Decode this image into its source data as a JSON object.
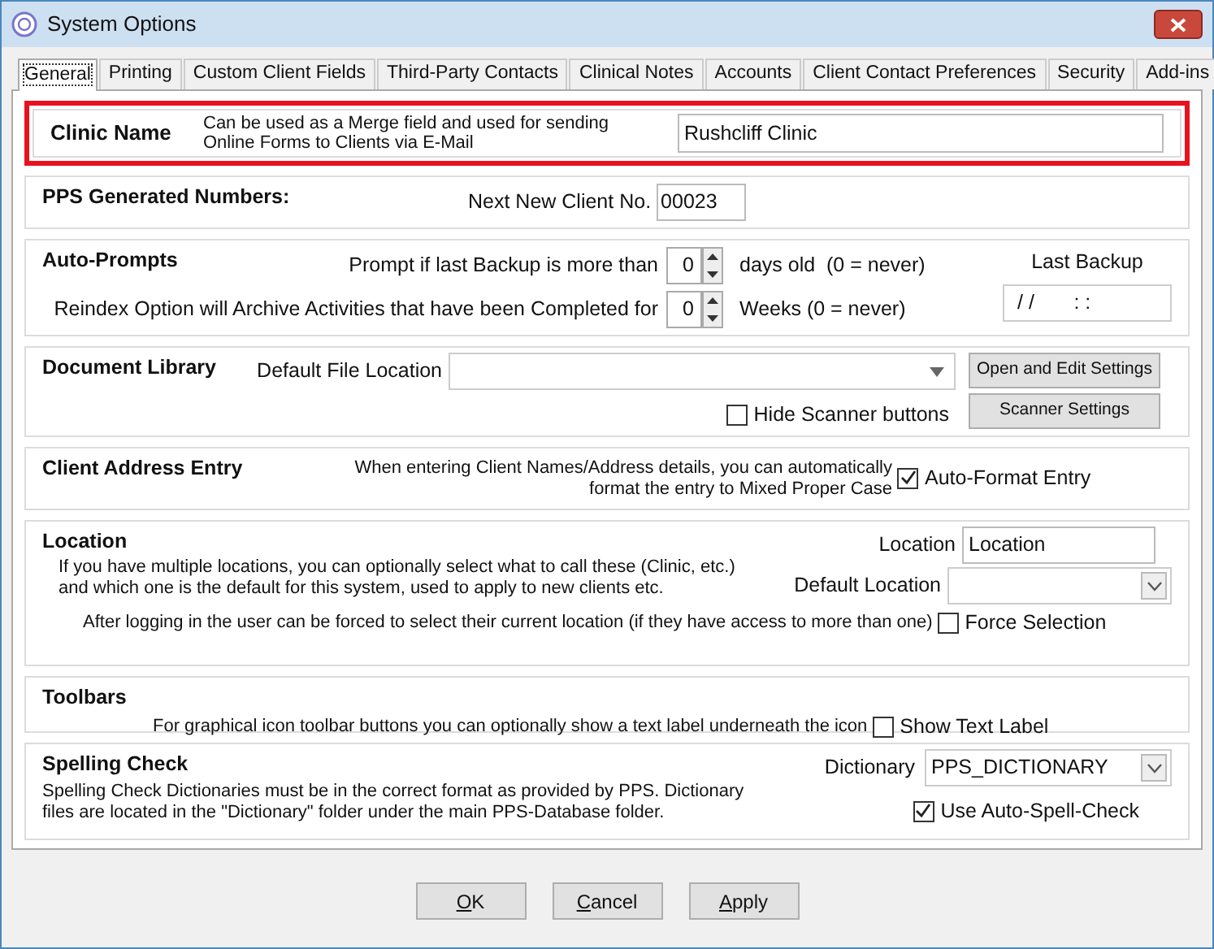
{
  "window": {
    "title": "System Options"
  },
  "tabs": [
    {
      "label": "General",
      "selected": true
    },
    {
      "label": "Printing",
      "selected": false
    },
    {
      "label": "Custom Client Fields",
      "selected": false
    },
    {
      "label": "Third-Party Contacts",
      "selected": false
    },
    {
      "label": "Clinical Notes",
      "selected": false
    },
    {
      "label": "Accounts",
      "selected": false
    },
    {
      "label": "Client Contact Preferences",
      "selected": false
    },
    {
      "label": "Security",
      "selected": false
    },
    {
      "label": "Add-ins",
      "selected": false
    }
  ],
  "clinic_name": {
    "title": "Clinic Name",
    "hint": "Can be used as a Merge field and used for sending Online Forms to Clients via E-Mail",
    "value": "Rushcliff Clinic",
    "highlighted": true
  },
  "pps_numbers": {
    "title": "PPS Generated Numbers:",
    "label": "Next New Client No.",
    "value": "00023"
  },
  "auto_prompts": {
    "title": "Auto-Prompts",
    "backup_label": "Prompt if last Backup is more than",
    "backup_value": "0",
    "backup_suffix": "days old  (0 = never)",
    "reindex_label": "Reindex Option will Archive Activities that have been Completed for",
    "reindex_value": "0",
    "reindex_suffix": "Weeks (0 = never)",
    "last_backup_label": "Last Backup",
    "last_backup_value": "/ /       : :"
  },
  "document_library": {
    "title": "Document Library",
    "label": "Default File Location",
    "open_button": "Open and Edit Settings",
    "hide_scanner": {
      "label": "Hide Scanner buttons",
      "checked": false
    },
    "scanner_button": "Scanner Settings"
  },
  "client_address": {
    "title": "Client Address Entry",
    "hint": "When entering Client Names/Address details, you can automatically format the entry to Mixed Proper Case",
    "option": {
      "label": "Auto-Format Entry",
      "checked": true
    }
  },
  "location": {
    "title": "Location",
    "description": "If you have multiple locations, you can optionally select what to call these (Clinic, etc.) and which one is the default for this system, used to apply to new clients etc.",
    "location_label": "Location",
    "location_value": "Location",
    "default_label": "Default Location",
    "force_hint": "After logging in the user can be forced to select their current location (if they have access to more than one)",
    "force": {
      "label": "Force Selection",
      "checked": false
    }
  },
  "toolbars": {
    "title": "Toolbars",
    "hint": "For graphical icon toolbar buttons you can optionally show a text label underneath the icon",
    "option": {
      "label": "Show Text Label",
      "checked": false
    }
  },
  "spelling": {
    "title": "Spelling Check",
    "description": "Spelling Check Dictionaries must be in the correct format as provided by PPS. Dictionary files are located in the \"Dictionary\" folder under the main PPS-Database folder.",
    "dictionary_label": "Dictionary",
    "dictionary_value": "PPS_DICTIONARY",
    "auto_spell": {
      "label": "Use Auto-Spell-Check",
      "checked": true
    }
  },
  "buttons": [
    {
      "label": "OK",
      "mnemonic": true
    },
    {
      "label": "Cancel",
      "mnemonic": true
    },
    {
      "label": "Apply",
      "mnemonic": true
    }
  ]
}
